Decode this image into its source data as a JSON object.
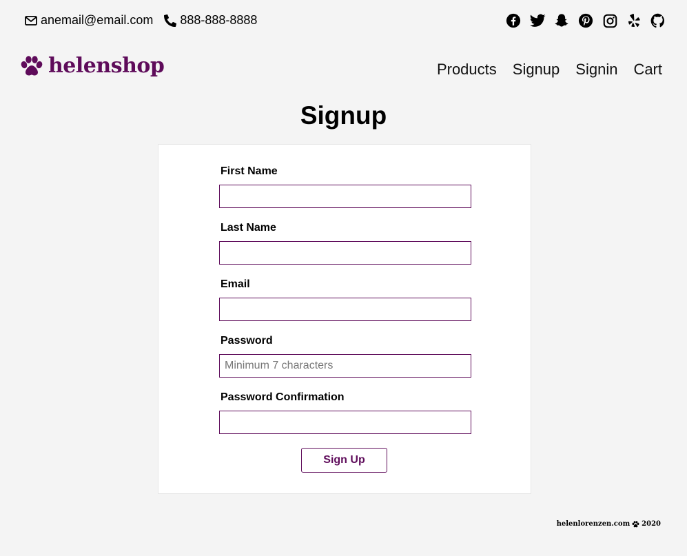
{
  "contact": {
    "email": "anemail@email.com",
    "phone": "888-888-8888",
    "email_icon": "envelope-icon",
    "phone_icon": "phone-icon"
  },
  "social": [
    "facebook-icon",
    "twitter-icon",
    "snapchat-icon",
    "pinterest-icon",
    "instagram-icon",
    "yelp-icon",
    "github-icon"
  ],
  "brand": {
    "name": "helenshop",
    "icon": "paw-icon",
    "color": "#5e0b5a"
  },
  "nav": {
    "products": "Products",
    "signup": "Signup",
    "signin": "Signin",
    "cart": "Cart"
  },
  "page": {
    "title": "Signup"
  },
  "form": {
    "first_name": {
      "label": "First Name",
      "placeholder": "",
      "value": ""
    },
    "last_name": {
      "label": "Last Name",
      "placeholder": "",
      "value": ""
    },
    "email": {
      "label": "Email",
      "placeholder": "",
      "value": ""
    },
    "password": {
      "label": "Password",
      "placeholder": "Minimum 7 characters",
      "value": ""
    },
    "password_confirmation": {
      "label": "Password Confirmation",
      "placeholder": "",
      "value": ""
    },
    "submit_label": "Sign Up"
  },
  "footer": {
    "site": "helenlorenzen.com",
    "year": "2020"
  }
}
